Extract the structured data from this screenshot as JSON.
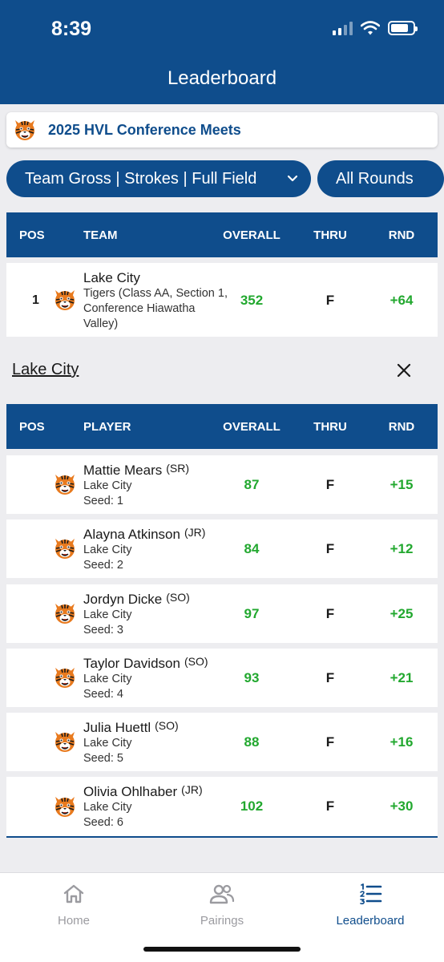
{
  "status_bar": {
    "time": "8:39",
    "battery_level": 0.8
  },
  "header": {
    "title": "Leaderboard"
  },
  "meet": {
    "title": "2025 HVL Conference Meets",
    "logo_icon": "tiger-logo-icon"
  },
  "filters": {
    "view": "Team Gross | Strokes | Full Field",
    "rounds": "All Rounds"
  },
  "team_table": {
    "columns": [
      "POS",
      "TEAM",
      "OVERALL",
      "THRU",
      "RND"
    ],
    "rows": [
      {
        "pos": "1",
        "name": "Lake City",
        "detail": "Tigers (Class AA, Section 1, Conference Hiawatha Valley)",
        "overall": "352",
        "thru": "F",
        "rnd": "+64"
      }
    ]
  },
  "selected_team": {
    "label": "Lake City"
  },
  "player_table": {
    "columns": [
      "POS",
      "PLAYER",
      "OVERALL",
      "THRU",
      "RND"
    ],
    "rows": [
      {
        "name": "Mattie Mears",
        "grade": "(SR)",
        "team": "Lake City",
        "seed": "Seed: 1",
        "overall": "87",
        "thru": "F",
        "rnd": "+15"
      },
      {
        "name": "Alayna Atkinson",
        "grade": "(JR)",
        "team": "Lake City",
        "seed": "Seed: 2",
        "overall": "84",
        "thru": "F",
        "rnd": "+12"
      },
      {
        "name": "Jordyn Dicke",
        "grade": "(SO)",
        "team": "Lake City",
        "seed": "Seed: 3",
        "overall": "97",
        "thru": "F",
        "rnd": "+25"
      },
      {
        "name": "Taylor Davidson",
        "grade": "(SO)",
        "team": "Lake City",
        "seed": "Seed: 4",
        "overall": "93",
        "thru": "F",
        "rnd": "+21"
      },
      {
        "name": "Julia Huettl",
        "grade": "(SO)",
        "team": "Lake City",
        "seed": "Seed: 5",
        "overall": "88",
        "thru": "F",
        "rnd": "+16"
      },
      {
        "name": "Olivia Ohlhaber",
        "grade": "(JR)",
        "team": "Lake City",
        "seed": "Seed: 6",
        "overall": "102",
        "thru": "F",
        "rnd": "+30"
      }
    ]
  },
  "tabbar": {
    "home": {
      "label": "Home",
      "icon": "home-icon"
    },
    "pairings": {
      "label": "Pairings",
      "icon": "people-icon"
    },
    "leaderboard": {
      "label": "Leaderboard",
      "icon": "ranked-list-icon",
      "active": true
    }
  },
  "colors": {
    "primary": "#0f4d8c",
    "score_green": "#22a82f",
    "background": "#ededf0"
  }
}
